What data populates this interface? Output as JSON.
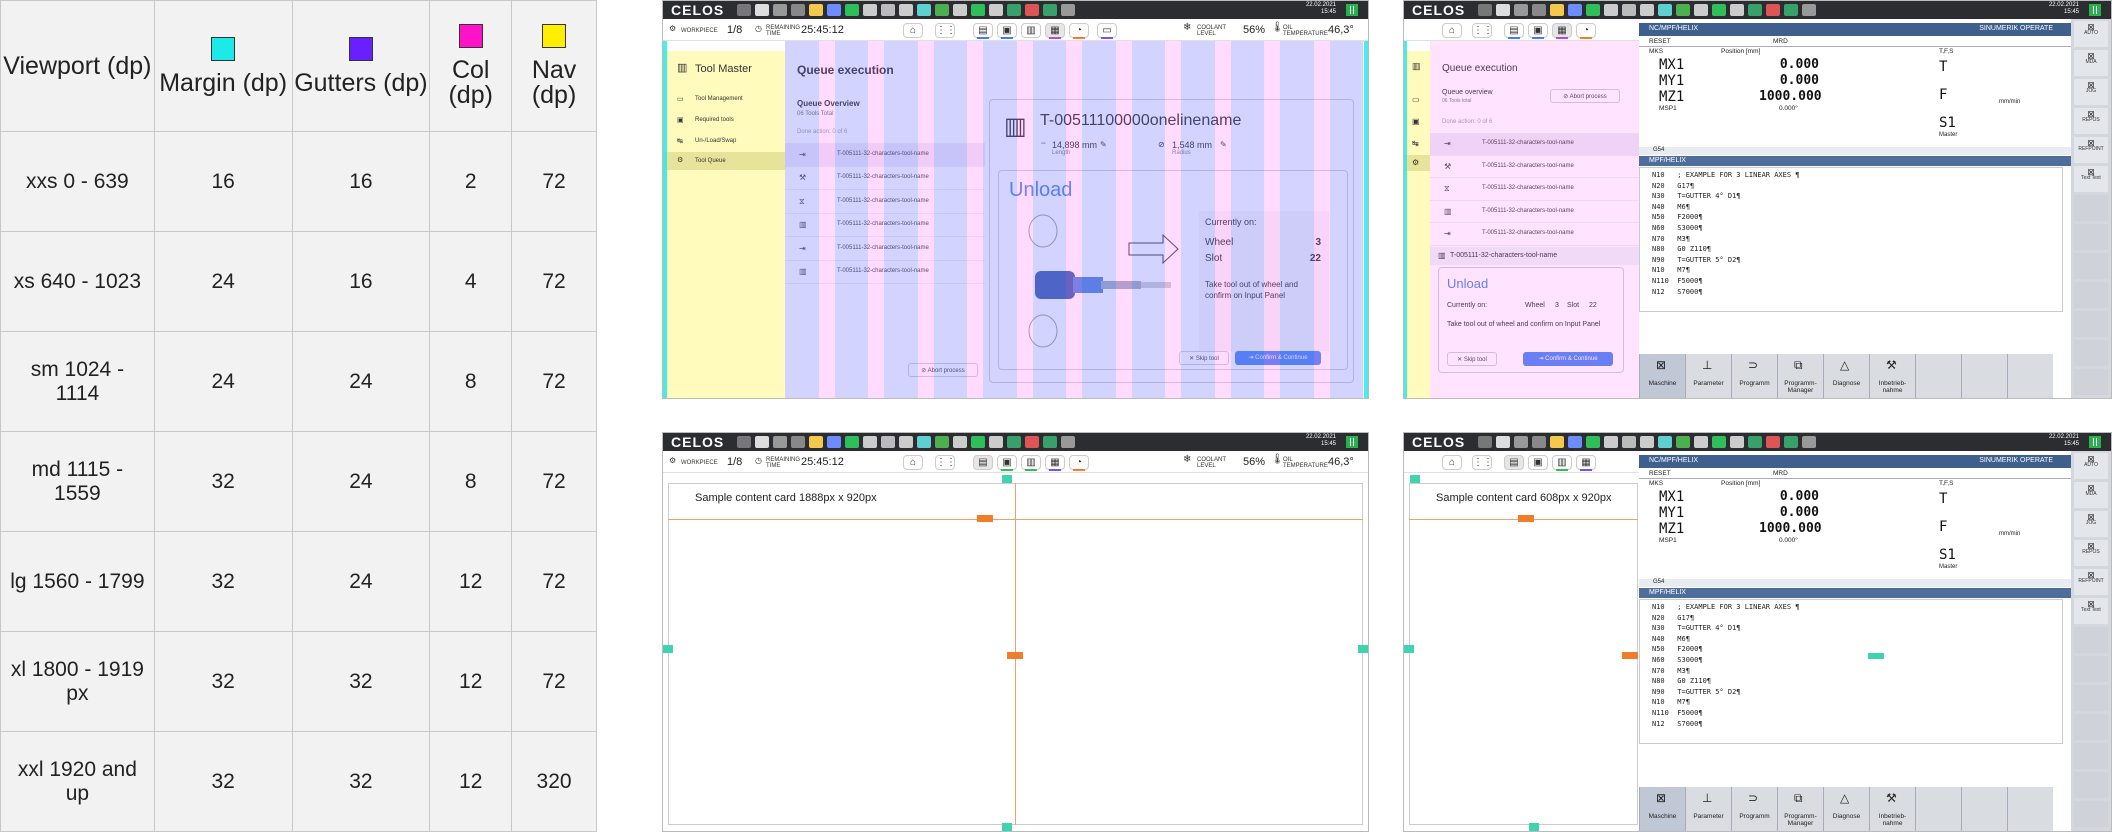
{
  "table": {
    "headers": [
      {
        "label": "Viewport (dp)",
        "color": ""
      },
      {
        "label": "Margin (dp)",
        "color": "#1de9e9"
      },
      {
        "label": "Gutters (dp)",
        "color": "#6a1fff"
      },
      {
        "label": "Col (dp)",
        "color": "#ff12c8"
      },
      {
        "label": "Nav (dp)",
        "color": "#ffee00"
      }
    ],
    "rows": [
      {
        "viewport": "xxs 0 - 639",
        "margin": "16",
        "gutters": "16",
        "col": "2",
        "nav": "72"
      },
      {
        "viewport": "xs 640 - 1023",
        "margin": "24",
        "gutters": "16",
        "col": "4",
        "nav": "72"
      },
      {
        "viewport": "sm 1024 - 1114",
        "margin": "24",
        "gutters": "24",
        "col": "8",
        "nav": "72"
      },
      {
        "viewport": "md 1115 - 1559",
        "margin": "32",
        "gutters": "24",
        "col": "8",
        "nav": "72"
      },
      {
        "viewport": "lg 1560 - 1799",
        "margin": "32",
        "gutters": "24",
        "col": "12",
        "nav": "72"
      },
      {
        "viewport": "xl 1800 - 1919 px",
        "margin": "32",
        "gutters": "32",
        "col": "12",
        "nav": "72"
      },
      {
        "viewport": "xxl 1920 and up",
        "margin": "32",
        "gutters": "32",
        "col": "12",
        "nav": "320"
      }
    ]
  },
  "celos": {
    "logo": "CELOS",
    "date": "22.02.2021",
    "time": "15:45",
    "workpiece_label": "WORKPIECE",
    "workpiece_value": "1/8",
    "remaining_label": "REMAINING TIME",
    "remaining_value": "25:45:12",
    "coolant_label": "COOLANT LEVEL",
    "coolant_value": "56%",
    "oil_label": "OIL TEMPERATURE",
    "oil_value": "46,3°"
  },
  "toolmaster": {
    "app_title": "Tool Master",
    "nav": [
      "Tool Management",
      "Required tools",
      "Un-/Load/Swap",
      "Tool Queue"
    ],
    "page_title": "Queue execution",
    "overview_title": "Queue Overview",
    "overview_sub": "06 Tools Total",
    "done_label": "Done action: 0 of 6",
    "tool_name": "T-005111-32-characters-tool-name",
    "abort": "Abort process",
    "detail_title": "T-00511100000onelinename",
    "length_value": "14,898 mm",
    "length_label": "Length",
    "radius_value": "1,548 mm",
    "radius_label": "Radius",
    "unload": "Unload",
    "currently_on": "Currently on:",
    "wheel_label": "Wheel",
    "wheel_value": "3",
    "slot_label": "Slot",
    "slot_value": "22",
    "instruction": "Take tool out of wheel and confirm on Input Panel",
    "skip": "Skip tool",
    "confirm": "Confirm & Continue"
  },
  "compact": {
    "overview_title": "Queue overview",
    "overview_sub": "06 Tools total",
    "done_label": "Done action: 0 of 6",
    "abort": "Abort process",
    "tool_name": "T-005111-32-characters-tool-name",
    "unload": "Unload",
    "currently_on": "Currently on:",
    "wheel_label": "Wheel",
    "wheel_value": "3",
    "slot_label": "Slot",
    "slot_value": "22",
    "instruction": "Take tool out of wheel and confirm on Input Panel",
    "skip": "Skip tool",
    "confirm": "Confirm & Continue"
  },
  "sinumerik": {
    "path": "NC/MPF/HELIX",
    "brand": "SINUMERIK OPERATE",
    "reset": "RESET",
    "mrd": "MRD",
    "mks": "MKS",
    "position": "Position [mm]",
    "tfs": "T,F,S",
    "axes": [
      {
        "name": "MX1",
        "value": "0.000"
      },
      {
        "name": "MY1",
        "value": "0.000"
      },
      {
        "name": "MZ1",
        "value": "1000.000"
      }
    ],
    "msp": "MSP1",
    "msp_value": "0.000°",
    "t": "T",
    "f": "F",
    "f_unit": "mm/min",
    "s": "S1",
    "master": "Master",
    "g_label": "G54",
    "prog_title": "MPF/HELIX",
    "lines": [
      "N10   ; EXAMPLE FOR 3 LINEAR AXES ¶",
      "N20   G17¶",
      "N30   T=GUTTER 4° D1¶",
      "N40   M6¶",
      "N50   F2000¶",
      "N60   S3000¶",
      "N70   M3¶",
      "N80   G0 Z110¶",
      "N90   T=GUTTER 5° D2¶",
      "N10   M7¶",
      "N110  F5000¶",
      "N12   S7000¶"
    ],
    "softkeys": [
      "Maschine",
      "Parameter",
      "Programm",
      "Programm-Manager",
      "Diagnose",
      "Inbetrieb-nahme"
    ],
    "right_keys": [
      "AUTO",
      "MDA",
      "JOG",
      "REPOS",
      "REFPOINT",
      "Text Text"
    ]
  },
  "cards": {
    "wide": "Sample content card 1888px x 920px",
    "narrow": "Sample content card 608px x 920px"
  }
}
